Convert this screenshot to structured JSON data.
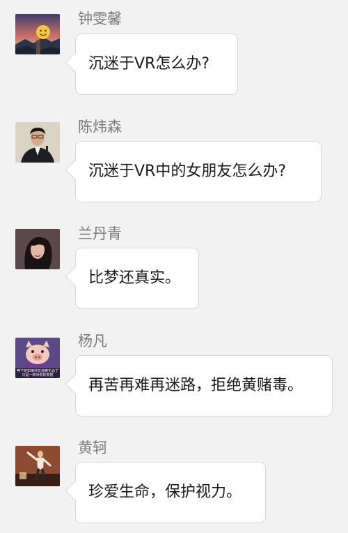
{
  "messages": [
    {
      "name": "钟雯馨",
      "text": "沉迷于VR怎么办?"
    },
    {
      "name": "陈炜森",
      "text": "沉迷于VR中的女朋友怎么办?"
    },
    {
      "name": "兰丹青",
      "text": "比梦还真实。"
    },
    {
      "name": "杨凡",
      "text": "再苦再难再迷路，拒绝黄赌毒。",
      "avatar_caption": "等下班如果你又迷路无话了 只是一种对你的安慰"
    },
    {
      "name": "黄轲",
      "text": "珍爱生命，保护视力。"
    }
  ],
  "colors": {
    "background": "#f2f2f2",
    "bubble": "#ffffff",
    "bubble_border": "#d6d6d6",
    "name_text": "#7a7a7a",
    "message_text": "#1a1a1a"
  }
}
